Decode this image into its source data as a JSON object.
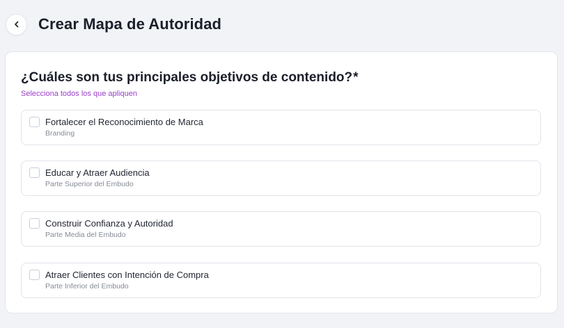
{
  "header": {
    "back_icon": "chevron-left-icon",
    "title": "Crear Mapa de Autoridad"
  },
  "form": {
    "question": "¿Cuáles son tus principales objetivos de contenido?",
    "required_mark": "*",
    "hint": "Selecciona todos los que apliquen",
    "hint_color": "#9b3fc6",
    "options": [
      {
        "title": "Fortalecer el Reconocimiento de Marca",
        "subtitle": "Branding",
        "checked": false
      },
      {
        "title": "Educar y Atraer Audiencia",
        "subtitle": "Parte Superior del Embudo",
        "checked": false
      },
      {
        "title": "Construir Confianza y Autoridad",
        "subtitle": "Parte Media del Embudo",
        "checked": false
      },
      {
        "title": "Atraer Clientes con Intención de Compra",
        "subtitle": "Parte Inferior del Embudo",
        "checked": false
      }
    ]
  }
}
